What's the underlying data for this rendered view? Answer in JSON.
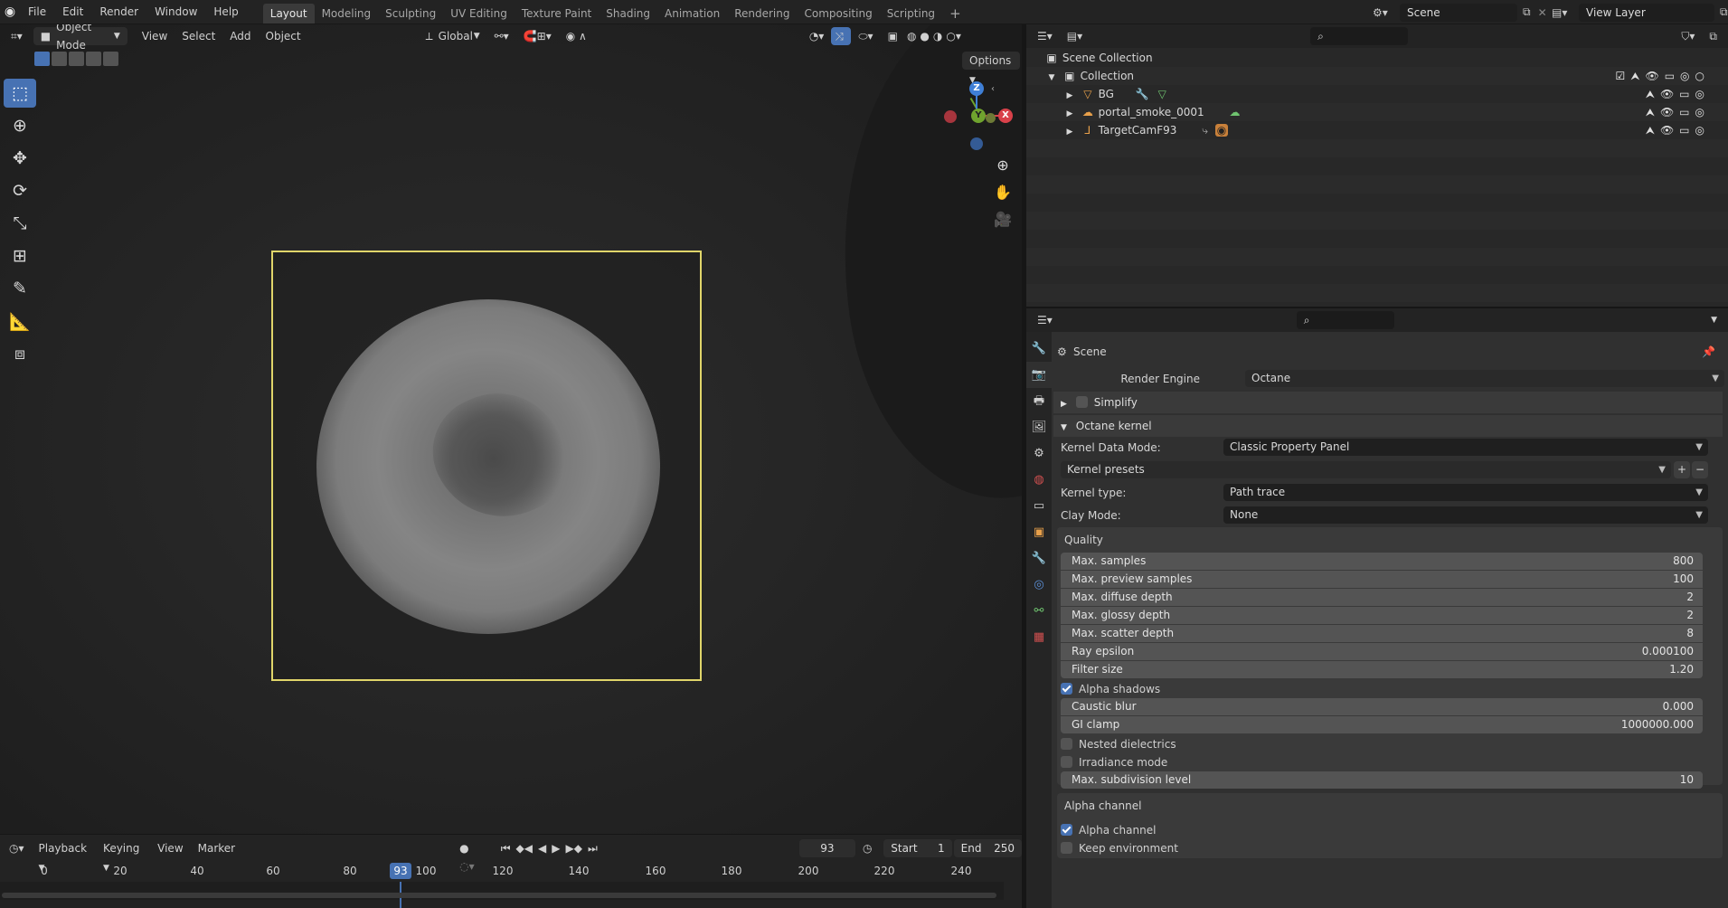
{
  "topbar": {
    "menus": [
      "File",
      "Edit",
      "Render",
      "Window",
      "Help"
    ],
    "workspaces": [
      "Layout",
      "Modeling",
      "Sculpting",
      "UV Editing",
      "Texture Paint",
      "Shading",
      "Animation",
      "Rendering",
      "Compositing",
      "Scripting"
    ],
    "active_workspace": "Layout",
    "add_tab": "+",
    "scene_name": "Scene",
    "view_layer": "View Layer"
  },
  "viewport": {
    "mode": "Object Mode",
    "menus": [
      "View",
      "Select",
      "Add",
      "Object"
    ],
    "transform_orientation": "Global",
    "options_label": "Options",
    "gizmo": {
      "z": "Z",
      "x": "X",
      "y": "Y"
    }
  },
  "timeline": {
    "menus": [
      "Playback",
      "Keying",
      "View",
      "Marker"
    ],
    "current_frame": "93",
    "start_label": "Start",
    "start_value": "1",
    "end_label": "End",
    "end_value": "250",
    "ruler_ticks": [
      "0",
      "20",
      "40",
      "60",
      "80",
      "100",
      "120",
      "140",
      "160",
      "180",
      "200",
      "220",
      "240"
    ],
    "playhead_label": "93"
  },
  "outliner": {
    "scene_collection": "Scene Collection",
    "collection": "Collection",
    "items": [
      {
        "name": "BG"
      },
      {
        "name": "portal_smoke_0001"
      },
      {
        "name": "TargetCamF93"
      }
    ]
  },
  "properties": {
    "context": "Scene",
    "render_engine_label": "Render Engine",
    "render_engine_value": "Octane",
    "simplify": "Simplify",
    "octane_kernel": "Octane kernel",
    "kernel_data_mode_label": "Kernel Data Mode:",
    "kernel_data_mode_value": "Classic Property Panel",
    "kernel_presets": "Kernel presets",
    "kernel_type_label": "Kernel type:",
    "kernel_type_value": "Path trace",
    "clay_mode_label": "Clay Mode:",
    "clay_mode_value": "None",
    "quality_label": "Quality",
    "quality": [
      {
        "label": "Max. samples",
        "value": "800"
      },
      {
        "label": "Max. preview samples",
        "value": "100"
      },
      {
        "label": "Max. diffuse depth",
        "value": "2"
      },
      {
        "label": "Max. glossy depth",
        "value": "2"
      },
      {
        "label": "Max. scatter depth",
        "value": "8"
      },
      {
        "label": "Ray epsilon",
        "value": "0.000100"
      },
      {
        "label": "Filter size",
        "value": "1.20"
      }
    ],
    "alpha_shadows": "Alpha shadows",
    "caustic_blur_label": "Caustic blur",
    "caustic_blur_value": "0.000",
    "gi_clamp_label": "GI clamp",
    "gi_clamp_value": "1000000.000",
    "nested_dielectrics": "Nested dielectrics",
    "irradiance_mode": "Irradiance mode",
    "max_subdiv_label": "Max. subdivision level",
    "max_subdiv_value": "10",
    "alpha_channel_section": "Alpha channel",
    "alpha_channel": "Alpha channel",
    "keep_environment": "Keep environment"
  },
  "colors": {
    "accent": "#4772b3",
    "camera_frame": "#e0d56a",
    "gizmo_x": "#d9414a",
    "gizmo_y": "#6fa32e",
    "gizmo_z": "#3f7fd6"
  }
}
